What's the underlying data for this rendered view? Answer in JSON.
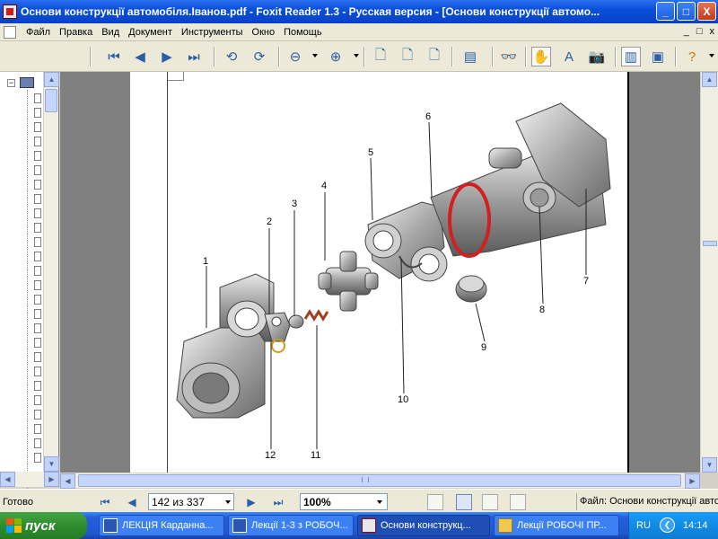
{
  "window": {
    "title": "Основи конструкції автомобіля.Іванов.pdf - Foxit Reader 1.3 - Русская версия  - [Основи конструкції автомо...",
    "minimize": "_",
    "maximize": "□",
    "close": "X"
  },
  "menu": {
    "items": [
      "Файл",
      "Правка",
      "Вид",
      "Документ",
      "Инструменты",
      "Окно",
      "Помощь"
    ],
    "mdi": [
      "_",
      "□",
      "x"
    ]
  },
  "toolbar": {
    "icons": [
      "first-page-icon",
      "prev-page-icon",
      "next-page-icon",
      "last-page-icon",
      "rotate-left-icon",
      "rotate-right-icon",
      "zoom-out-icon",
      "zoom-in-icon",
      "page-icon",
      "page-width-icon",
      "page-fit-icon",
      "form-icon",
      "find-icon",
      "hand-tool-icon",
      "text-select-icon",
      "snapshot-icon",
      "bookmarks-panel-icon",
      "thumbnail-icon",
      "help-icon"
    ]
  },
  "diagram": {
    "labels": [
      "1",
      "2",
      "3",
      "4",
      "5",
      "6",
      "7",
      "8",
      "9",
      "10",
      "11",
      "12"
    ]
  },
  "status": {
    "ready": "Готово",
    "page_field": "142 из 337",
    "zoom_field": "100%",
    "file": "Файл: Основи конструкції автомобіля"
  },
  "taskbar": {
    "start": "пуск",
    "tasks": [
      "ЛЕКЦІЯ Карданна...",
      "Лекції 1-3 з РОБОЧ...",
      "Основи конструкц...",
      "Лекції РОБОЧІ ПР..."
    ],
    "lang": "RU",
    "clock": "14:14"
  }
}
